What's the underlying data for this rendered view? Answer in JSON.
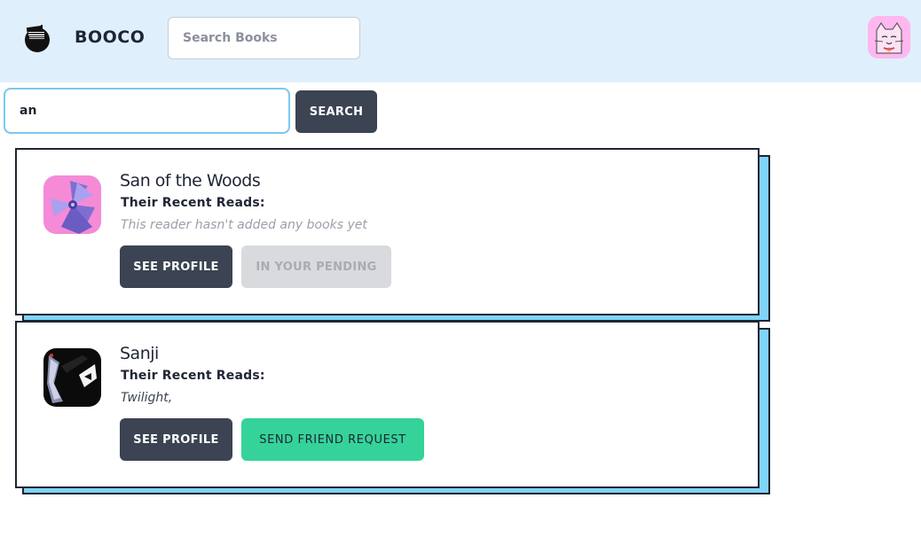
{
  "header": {
    "brand": "BOOCO",
    "search_placeholder": "Search Books",
    "logo_icon": "book-stack-icon",
    "avatar_icon": "cat-avatar-icon"
  },
  "user_search": {
    "query": "an",
    "button_label": "SEARCH"
  },
  "results": [
    {
      "name": "San of the Woods",
      "reads_label": "Their Recent Reads:",
      "reads": "This reader hasn't added any books yet",
      "avatar_icon": "pinwheel-avatar-icon",
      "profile_label": "SEE PROFILE",
      "action_label": "IN YOUR PENDING"
    },
    {
      "name": "Sanji",
      "reads_label": "Their Recent Reads:",
      "reads": "Twilight,",
      "avatar_icon": "character-avatar-icon",
      "profile_label": "SEE PROFILE",
      "action_label": "SEND FRIEND REQUEST"
    }
  ],
  "colors": {
    "navbar": "#dff0fc",
    "dark_button": "#3c4352",
    "friend_button": "#35d399",
    "card_shadow": "#7fd4f8",
    "pending_button": "#d8dadd"
  }
}
